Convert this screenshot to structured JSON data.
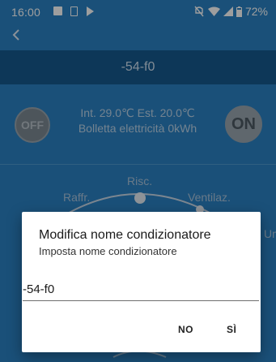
{
  "status_bar": {
    "time": "16:00",
    "battery": "72%",
    "icons": [
      "image-icon",
      "sim-icon",
      "play-icon",
      "mute-icon",
      "wifi-icon",
      "signal-icon",
      "battery-icon"
    ]
  },
  "header": {
    "back_icon": "chevron-left-icon",
    "title": "-54-f0"
  },
  "controls": {
    "off_label": "OFF",
    "on_label": "ON",
    "temps_line": "Int. 29.0℃ Est. 20.0℃",
    "bill_line": "Bolletta elettricità 0kWh"
  },
  "modes": {
    "risc": "Risc.",
    "raffr": "Raffr.",
    "ventilaz": "Ventilaz.",
    "deum": "Umidif."
  },
  "dialog": {
    "title": "Modifica nome condizionatore",
    "message": "Imposta nome condizionatore",
    "input_value": "-54-f0",
    "no_label": "NO",
    "yes_label": "SÌ"
  },
  "colors": {
    "background": "#2b82c4",
    "title_bar": "#16598f",
    "dialog": "#ffffff"
  }
}
